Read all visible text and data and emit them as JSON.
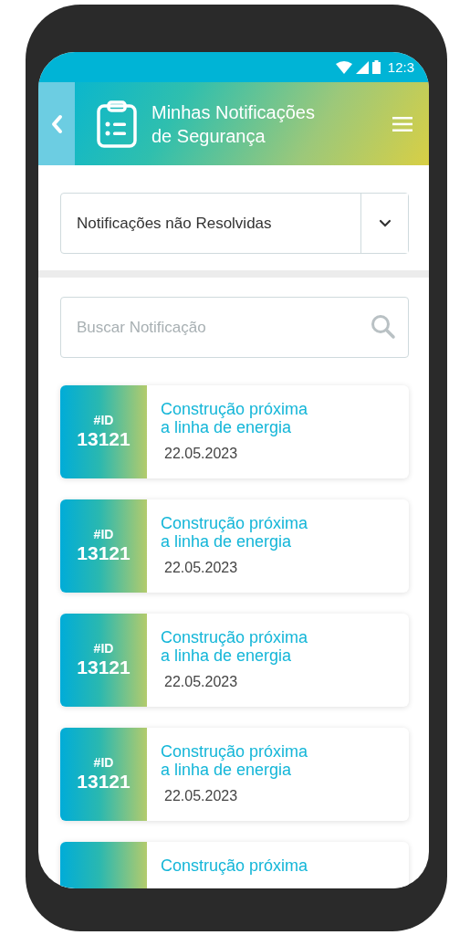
{
  "status_bar": {
    "time": "12:3"
  },
  "header": {
    "title": "Minhas Notificações de Segurança"
  },
  "filter": {
    "value": "Notificações não Resolvidas"
  },
  "search": {
    "placeholder": "Buscar Notificação"
  },
  "notifications": [
    {
      "id_label": "#ID",
      "id": "13121",
      "title": "Construção próxima a linha de energia",
      "date": "22.05.2023"
    },
    {
      "id_label": "#ID",
      "id": "13121",
      "title": "Construção próxima a linha de energia",
      "date": "22.05.2023"
    },
    {
      "id_label": "#ID",
      "id": "13121",
      "title": "Construção próxima a linha de energia",
      "date": "22.05.2023"
    },
    {
      "id_label": "#ID",
      "id": "13121",
      "title": "Construção próxima a linha de energia",
      "date": "22.05.2023"
    },
    {
      "title": "Construção próxima"
    }
  ]
}
